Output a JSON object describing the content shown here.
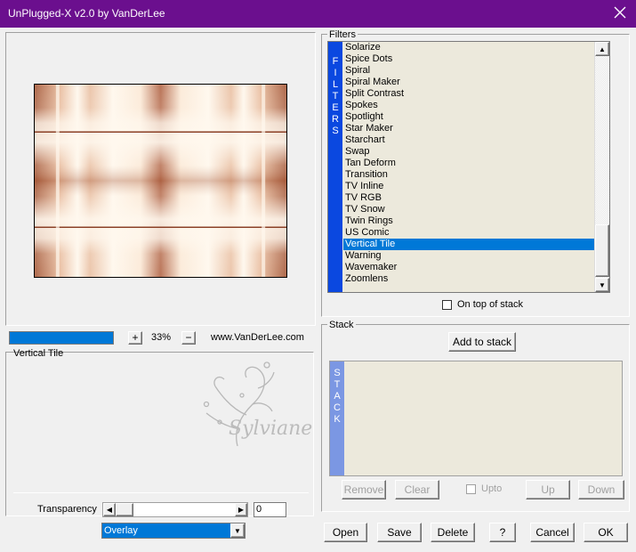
{
  "window": {
    "title": "UnPlugged-X v2.0 by VanDerLee"
  },
  "preview": {
    "zoom_value": "33%",
    "website": "www.VanDerLee.com",
    "zoom_in_label": "+",
    "zoom_out_label": "−",
    "progress": 1.0
  },
  "filters": {
    "group_title": "Filters",
    "vertical_label": "FILTERS",
    "items": [
      "Solarize",
      "Spice Dots",
      "Spiral",
      "Spiral Maker",
      "Split Contrast",
      "Spokes",
      "Spotlight",
      "Star Maker",
      "Starchart",
      "Swap",
      "Tan Deform",
      "Transition",
      "TV Inline",
      "TV RGB",
      "TV Snow",
      "Twin Rings",
      "US Comic",
      "Vertical Tile",
      "Warning",
      "Wavemaker",
      "Zoomlens"
    ],
    "selected": "Vertical Tile",
    "on_top_label": "On top of stack"
  },
  "stack": {
    "group_title": "Stack",
    "add_label": "Add to stack",
    "vertical_label": "STACK",
    "buttons": {
      "remove": "Remove",
      "clear": "Clear",
      "upto": "Upto",
      "up": "Up",
      "down": "Down"
    }
  },
  "params": {
    "group_title": "Vertical Tile",
    "transparency_label": "Transparency",
    "transparency_value": "0",
    "blend_mode": "Overlay",
    "watermark": "Sylviane"
  },
  "footer": {
    "open": "Open",
    "save": "Save",
    "delete": "Delete",
    "help": "?",
    "cancel": "Cancel",
    "ok": "OK"
  },
  "colors": {
    "titlebar": "#6b0f8e",
    "filter_bar": "#0a48e0",
    "stack_bar": "#7b97e3",
    "selection": "#0078d7",
    "tile_dark": "#a5593a",
    "tile_light": "#fff8ee"
  }
}
